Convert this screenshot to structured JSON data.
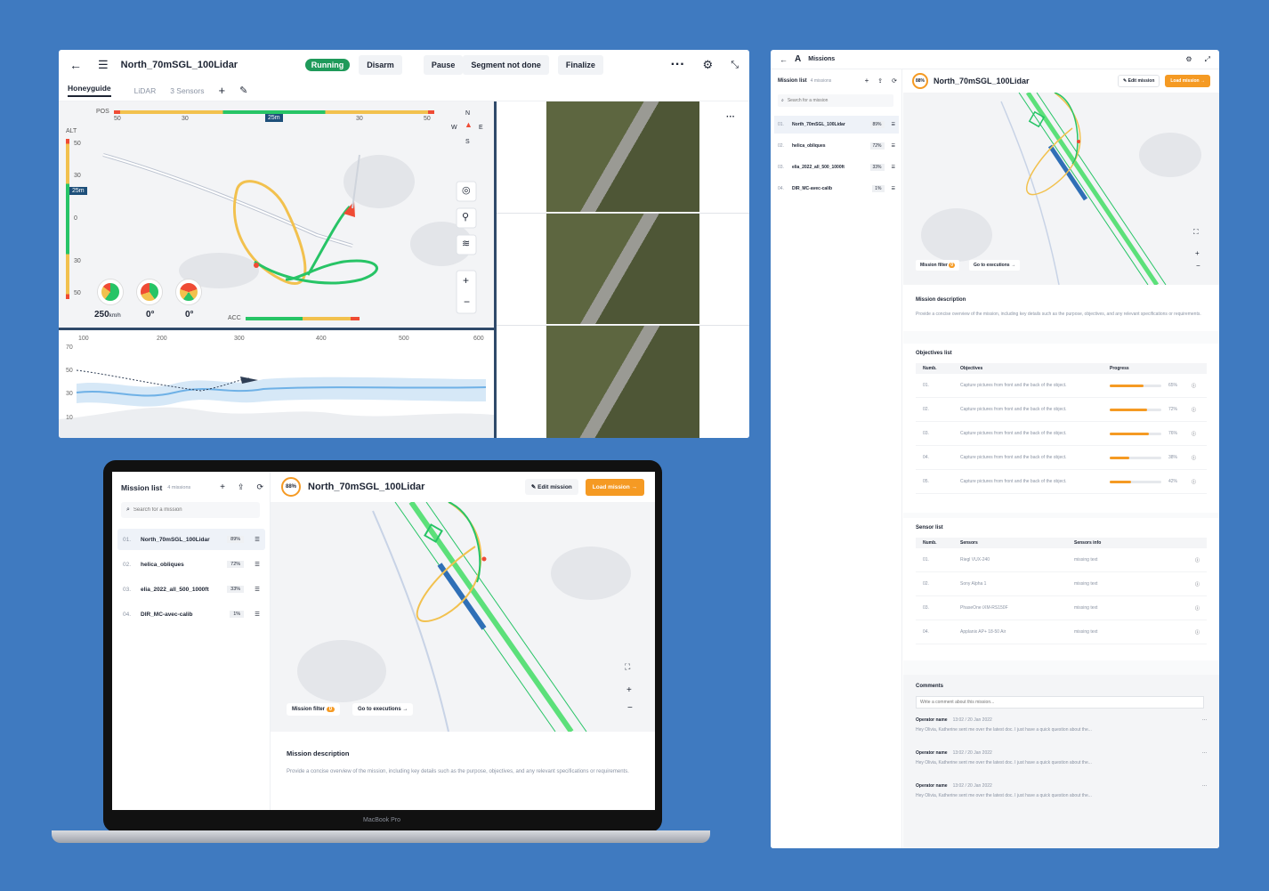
{
  "ops": {
    "title": "North_70mSGL_100Lidar",
    "status": "Running",
    "buttons": {
      "disarm": "Disarm",
      "pause": "Pause",
      "segment": "Segment not done",
      "finalize": "Finalize"
    },
    "tabs": [
      "Honeyguide",
      "LiDAR",
      "3 Sensors"
    ],
    "pos_label": "POS",
    "pos_ticks": [
      "50",
      "30",
      "30",
      "50"
    ],
    "pos_marker": "25m",
    "alt_label": "ALT",
    "alt_ticks": [
      "50",
      "30",
      "0",
      "30",
      "50"
    ],
    "alt_marker": "25m",
    "compass": {
      "n": "N",
      "s": "S",
      "w": "W",
      "e": "E"
    },
    "speed": "250",
    "speed_unit": "km/h",
    "pitch": "0°",
    "roll": "0°",
    "acc_label": "ACC",
    "elev_x_ticks": [
      "100",
      "200",
      "300",
      "400",
      "500",
      "600"
    ],
    "elev_y_ticks": [
      "70",
      "50",
      "30",
      "10"
    ]
  },
  "missions": {
    "header_title": "Missions",
    "list_title": "Mission list",
    "count_badge": "4 missions",
    "search_placeholder": "Search for a mission",
    "items": [
      {
        "num": "01.",
        "name": "North_70mSGL_100Lidar",
        "pct": "89%"
      },
      {
        "num": "02.",
        "name": "helica_obliques",
        "pct": "72%"
      },
      {
        "num": "03.",
        "name": "elia_2022_all_500_1000ft",
        "pct": "33%"
      },
      {
        "num": "04.",
        "name": "DIR_MC-avec-calib",
        "pct": "1%"
      }
    ],
    "detail_ring": "88%",
    "detail_title": "North_70mSGL_100Lidar",
    "edit_label": "Edit mission",
    "load_label": "Load mission",
    "filter_label": "Mission filter",
    "filter_count": "0",
    "exec_label": "Go to executions",
    "desc_title": "Mission description",
    "desc_text": "Provide a concise overview of the mission, including key details such as the purpose, objectives, and any relevant specifications or requirements.",
    "objectives_title": "Objectives list",
    "obj_headers": [
      "Numb.",
      "Objectives",
      "Progress"
    ],
    "objectives": [
      {
        "num": "01.",
        "text": "Capture pictures from front and the back of the object.",
        "pct": "65%",
        "value": 65
      },
      {
        "num": "02.",
        "text": "Capture pictures from front and the back of the object.",
        "pct": "72%",
        "value": 72
      },
      {
        "num": "03.",
        "text": "Capture pictures from front and the back of the object.",
        "pct": "76%",
        "value": 76
      },
      {
        "num": "04.",
        "text": "Capture pictures from front and the back of the object.",
        "pct": "38%",
        "value": 38
      },
      {
        "num": "05.",
        "text": "Capture pictures from front and the back of the object.",
        "pct": "42%",
        "value": 42
      }
    ],
    "sensors_title": "Sensor list",
    "sensor_headers": [
      "Numb.",
      "Sensors",
      "Sensors info"
    ],
    "sensors": [
      {
        "num": "01.",
        "name": "Riegl VUX-240",
        "info": "missing text"
      },
      {
        "num": "02.",
        "name": "Sony Alpha 1",
        "info": "missing text"
      },
      {
        "num": "03.",
        "name": "PhaseOne iXM-RS150F",
        "info": "missing text"
      },
      {
        "num": "04.",
        "name": "Applanix AP+ 18-50 Air",
        "info": "missing text"
      }
    ],
    "comments_title": "Comments",
    "comment_placeholder": "Write a comment about this mission...",
    "comments": [
      {
        "author": "Operator name",
        "time": "13:02 / 20 Jan 2022",
        "text": "Hey Olivia, Katherine sent me over the latest doc. I just have a quick question about the..."
      },
      {
        "author": "Operator name",
        "time": "13:02 / 20 Jan 2022",
        "text": "Hey Olivia, Katherine sent me over the latest doc. I just have a quick question about the..."
      },
      {
        "author": "Operator name",
        "time": "13:02 / 20 Jan 2022",
        "text": "Hey Olivia, Katherine sent me over the latest doc. I just have a quick question about the..."
      }
    ]
  },
  "laptop": {
    "brand": "MacBook Pro"
  },
  "colors": {
    "bg": "#3f7ac0",
    "orange": "#f59a23",
    "green": "#27c466",
    "running": "#1f9a5a",
    "yellow": "#f2c14e",
    "blue": "#2f6fb6"
  }
}
